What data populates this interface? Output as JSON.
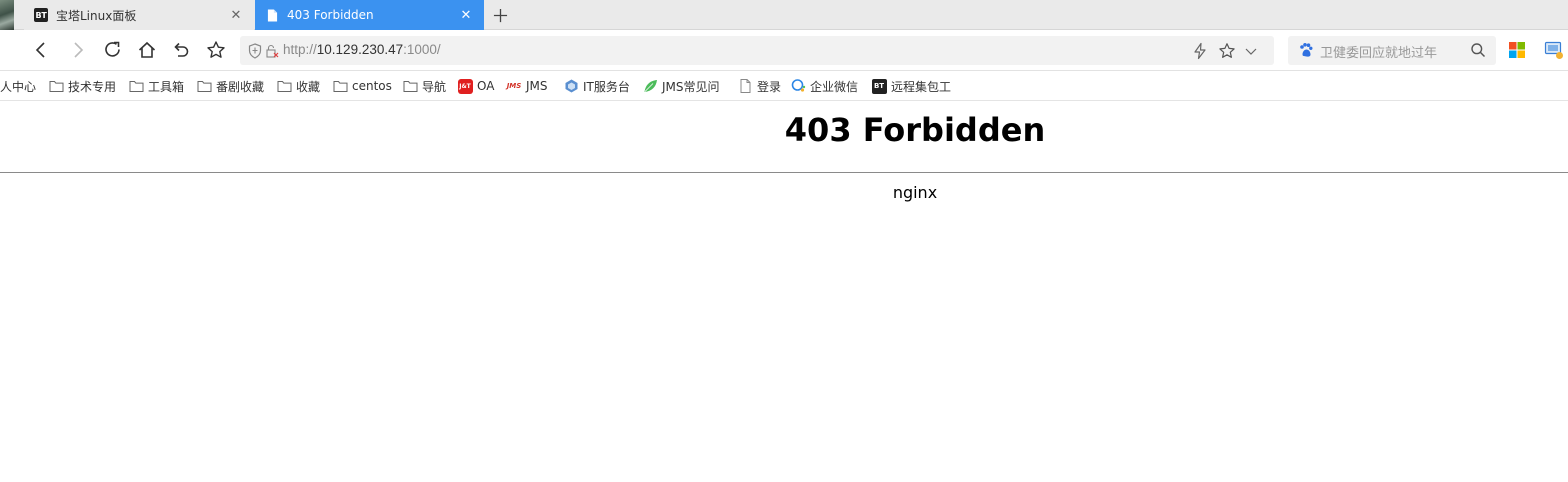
{
  "tabs": [
    {
      "title": "宝塔Linux面板",
      "favicon": "BT",
      "active": false
    },
    {
      "title": "403 Forbidden",
      "favicon": "page-icon",
      "active": true
    }
  ],
  "address_bar": {
    "url_scheme": "http://",
    "url_host": "10.129.230.47",
    "url_rest": ":1000/"
  },
  "search": {
    "placeholder": "卫健委回应就地过年"
  },
  "bookmarks": [
    {
      "label": "人中心",
      "icon": "none"
    },
    {
      "label": "技术专用",
      "icon": "folder-icon"
    },
    {
      "label": "工具箱",
      "icon": "folder-icon"
    },
    {
      "label": "番剧收藏",
      "icon": "folder-icon"
    },
    {
      "label": "收藏",
      "icon": "folder-icon"
    },
    {
      "label": "centos",
      "icon": "folder-icon"
    },
    {
      "label": "导航",
      "icon": "folder-icon"
    },
    {
      "label": "OA",
      "icon": "jt-logo-icon",
      "logo_text": "J&T"
    },
    {
      "label": "JMS",
      "icon": "jms-logo-icon",
      "logo_text": "JMS"
    },
    {
      "label": "IT服务台",
      "icon": "service-desk-icon"
    },
    {
      "label": "JMS常见问",
      "icon": "leaf-icon"
    },
    {
      "label": "登录",
      "icon": "page-icon"
    },
    {
      "label": "企业微信",
      "icon": "wecom-icon"
    },
    {
      "label": "远程集包工",
      "icon": "bt-logo-icon",
      "logo_text": "BT"
    }
  ],
  "page": {
    "heading": "403 Forbidden",
    "server": "nginx"
  },
  "colors": {
    "active_tab": "#3b92f0",
    "tabstrip_bg": "#eaeaea",
    "address_bg": "#f2f2f2"
  }
}
